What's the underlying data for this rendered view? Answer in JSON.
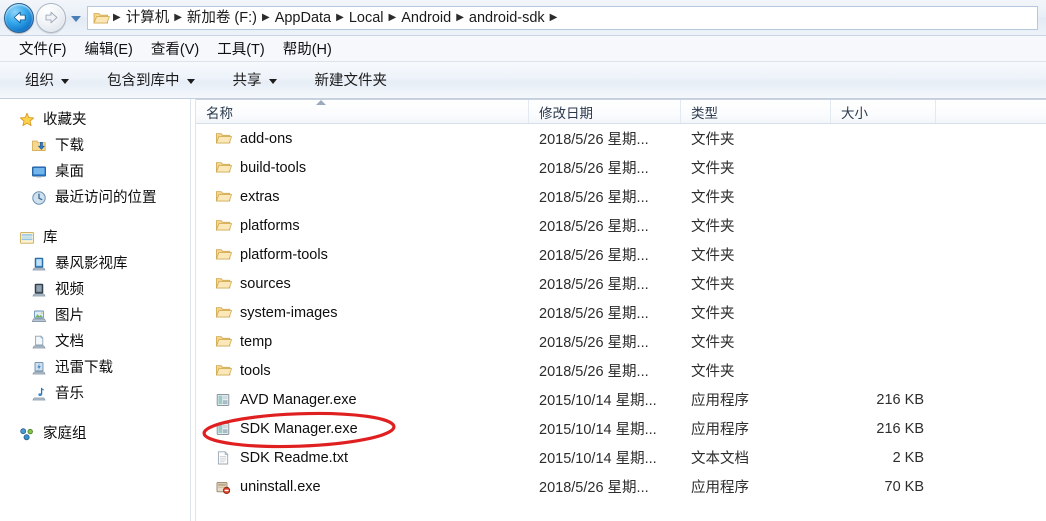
{
  "window": {
    "nav": {
      "back_label": "后退",
      "forward_label": "前进",
      "recent_dropdown_label": "最近的位置"
    },
    "breadcrumb": {
      "items": [
        "计算机",
        "新加卷 (F:)",
        "AppData",
        "Local",
        "Android",
        "android-sdk"
      ],
      "separator": "▸"
    }
  },
  "menubar": {
    "items": [
      {
        "label": "文件(F)",
        "name": "menu-file"
      },
      {
        "label": "编辑(E)",
        "name": "menu-edit"
      },
      {
        "label": "查看(V)",
        "name": "menu-view"
      },
      {
        "label": "工具(T)",
        "name": "menu-tools"
      },
      {
        "label": "帮助(H)",
        "name": "menu-help"
      }
    ]
  },
  "toolbar": {
    "items": [
      {
        "label": "组织",
        "caret": true,
        "name": "toolbar-organize"
      },
      {
        "label": "包含到库中",
        "caret": true,
        "name": "toolbar-include-in-library"
      },
      {
        "label": "共享",
        "caret": true,
        "name": "toolbar-share"
      },
      {
        "label": "新建文件夹",
        "caret": false,
        "name": "toolbar-new-folder"
      }
    ]
  },
  "navpane": {
    "groups": [
      {
        "header": {
          "label": "收藏夹",
          "icon": "star-icon"
        },
        "items": [
          {
            "label": "下载",
            "icon": "downloads-icon"
          },
          {
            "label": "桌面",
            "icon": "desktop-icon"
          },
          {
            "label": "最近访问的位置",
            "icon": "recent-places-icon"
          }
        ]
      },
      {
        "header": {
          "label": "库",
          "icon": "library-icon"
        },
        "items": [
          {
            "label": "暴风影视库",
            "icon": "baofeng-library-icon"
          },
          {
            "label": "视频",
            "icon": "videos-icon"
          },
          {
            "label": "图片",
            "icon": "pictures-icon"
          },
          {
            "label": "文档",
            "icon": "documents-icon"
          },
          {
            "label": "迅雷下载",
            "icon": "thunder-download-icon"
          },
          {
            "label": "音乐",
            "icon": "music-icon"
          }
        ]
      },
      {
        "header": {
          "label": "家庭组",
          "icon": "homegroup-icon"
        },
        "items": []
      }
    ]
  },
  "filelist": {
    "columns": [
      {
        "label": "名称",
        "name": "column-name",
        "sorted": true,
        "sort_dir": "asc"
      },
      {
        "label": "修改日期",
        "name": "column-date-modified",
        "sorted": false
      },
      {
        "label": "类型",
        "name": "column-type",
        "sorted": false
      },
      {
        "label": "大小",
        "name": "column-size",
        "sorted": false
      }
    ],
    "rows": [
      {
        "name": "add-ons",
        "date": "2018/5/26 星期...",
        "type": "文件夹",
        "size": "",
        "icon": "folder-icon"
      },
      {
        "name": "build-tools",
        "date": "2018/5/26 星期...",
        "type": "文件夹",
        "size": "",
        "icon": "folder-icon"
      },
      {
        "name": "extras",
        "date": "2018/5/26 星期...",
        "type": "文件夹",
        "size": "",
        "icon": "folder-icon"
      },
      {
        "name": "platforms",
        "date": "2018/5/26 星期...",
        "type": "文件夹",
        "size": "",
        "icon": "folder-icon"
      },
      {
        "name": "platform-tools",
        "date": "2018/5/26 星期...",
        "type": "文件夹",
        "size": "",
        "icon": "folder-icon"
      },
      {
        "name": "sources",
        "date": "2018/5/26 星期...",
        "type": "文件夹",
        "size": "",
        "icon": "folder-icon"
      },
      {
        "name": "system-images",
        "date": "2018/5/26 星期...",
        "type": "文件夹",
        "size": "",
        "icon": "folder-icon"
      },
      {
        "name": "temp",
        "date": "2018/5/26 星期...",
        "type": "文件夹",
        "size": "",
        "icon": "folder-icon"
      },
      {
        "name": "tools",
        "date": "2018/5/26 星期...",
        "type": "文件夹",
        "size": "",
        "icon": "folder-icon"
      },
      {
        "name": "AVD Manager.exe",
        "date": "2015/10/14 星期...",
        "type": "应用程序",
        "size": "216 KB",
        "icon": "exe-icon"
      },
      {
        "name": "SDK Manager.exe",
        "date": "2015/10/14 星期...",
        "type": "应用程序",
        "size": "216 KB",
        "icon": "exe-icon",
        "highlighted": true
      },
      {
        "name": "SDK Readme.txt",
        "date": "2015/10/14 星期...",
        "type": "文本文档",
        "size": "2 KB",
        "icon": "text-file-icon"
      },
      {
        "name": "uninstall.exe",
        "date": "2018/5/26 星期...",
        "type": "应用程序",
        "size": "70 KB",
        "icon": "uninstall-icon"
      }
    ]
  },
  "annotation": {
    "target_row": "SDK Manager.exe",
    "shape": "ellipse",
    "color": "#e02020"
  },
  "colors": {
    "accent": "#3d8ed6",
    "annotation_red": "#e02020",
    "folder_yellow": "#f7d27e",
    "header_text": "#2b3a4d"
  }
}
